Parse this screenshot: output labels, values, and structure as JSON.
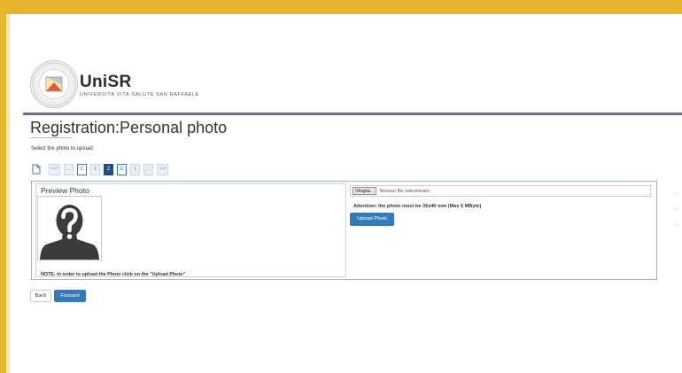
{
  "colors": {
    "frame": "#e8b62e",
    "divider": "#5e7391",
    "primary": "#337ab7",
    "active_step": "#1f4e86"
  },
  "header": {
    "logo_name": "UniSR",
    "logo_subtitle": "UNIVERSITÀ VITA-SALUTE SAN RAFFAELE"
  },
  "page": {
    "title": "Registration:Personal photo",
    "subtitle": "Select the photo to upload"
  },
  "steps": [
    {
      "label": "<<",
      "state": "normal"
    },
    {
      "label": "...",
      "state": "normal"
    },
    {
      "label": "C",
      "state": "boxed"
    },
    {
      "label": "1",
      "state": "normal"
    },
    {
      "label": "2",
      "state": "active"
    },
    {
      "label": "D",
      "state": "boxed"
    },
    {
      "label": "1",
      "state": "normal"
    },
    {
      "label": "...",
      "state": "normal"
    },
    {
      "label": ">>",
      "state": "normal"
    }
  ],
  "preview": {
    "title": "Preview Photo",
    "placeholder_icon": "unknown-person-icon",
    "note": "NOTE: In order to upload the Photo click on the \"Upload Photo\""
  },
  "upload": {
    "browse_label": "Sfoglia...",
    "file_status": "Nessun file selezionato.",
    "attention": "Attention: the photo must be 35x40 mm (Max 5 MByte)",
    "upload_label": "Upload Photo"
  },
  "actions": {
    "back_label": "Back",
    "forward_label": "Forward"
  }
}
